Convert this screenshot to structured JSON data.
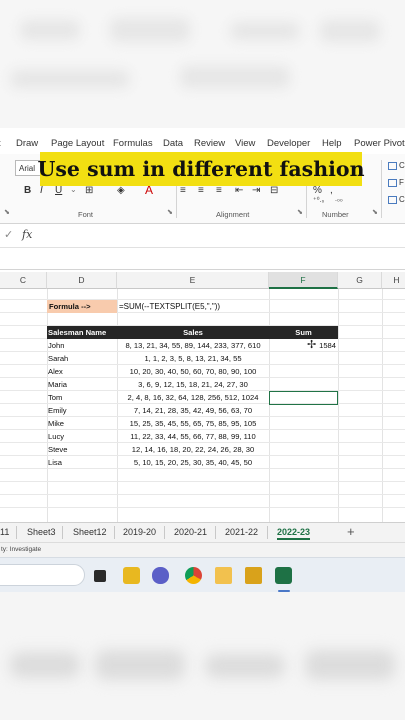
{
  "overlay": {
    "caption": "Use sum in different fashion"
  },
  "menu": {
    "items": [
      "t",
      "Draw",
      "Page Layout",
      "Formulas",
      "Data",
      "Review",
      "View",
      "Developer",
      "Help",
      "Power Pivot"
    ]
  },
  "ribbon": {
    "font_name": "Arial",
    "font_group_label": "Font",
    "alignment_group_label": "Alignment",
    "number_group_label": "Number",
    "bold": "B",
    "italic": "I",
    "underline": "U",
    "grow_font": "A",
    "shrink_font": "A",
    "font_color": "A",
    "side_items": [
      "C",
      "F",
      "C"
    ]
  },
  "formula_bar": {
    "fx": "fx"
  },
  "columns": [
    "C",
    "D",
    "E",
    "F",
    "G",
    "H"
  ],
  "active_column": "F",
  "sheet": {
    "formula_label": "Formula -->",
    "formula_text": "=SUM(--TEXTSPLIT(E5,\",\"))",
    "headers": {
      "salesman": "Salesman Name",
      "sales": "Sales",
      "sum": "Sum"
    },
    "rows": [
      {
        "name": "John",
        "sales": "8, 13, 21, 34, 55, 89, 144, 233, 377, 610",
        "sum": "1584"
      },
      {
        "name": "Sarah",
        "sales": "1, 1, 2, 3, 5, 8, 13, 21, 34, 55",
        "sum": ""
      },
      {
        "name": "Alex",
        "sales": "10, 20, 30, 40, 50, 60, 70, 80, 90, 100",
        "sum": ""
      },
      {
        "name": "Maria",
        "sales": "3, 6, 9, 12, 15, 18, 21, 24, 27, 30",
        "sum": ""
      },
      {
        "name": "Tom",
        "sales": "2, 4, 8, 16, 32, 64, 128, 256, 512, 1024",
        "sum": ""
      },
      {
        "name": "Emily",
        "sales": "7, 14, 21, 28, 35, 42, 49, 56, 63, 70",
        "sum": ""
      },
      {
        "name": "Mike",
        "sales": "15, 25, 35, 45, 55, 65, 75, 85, 95, 105",
        "sum": ""
      },
      {
        "name": "Lucy",
        "sales": "11, 22, 33, 44, 55, 66, 77, 88, 99, 110",
        "sum": ""
      },
      {
        "name": "Steve",
        "sales": "12, 14, 16, 18, 20, 22, 24, 26, 28, 30",
        "sum": ""
      },
      {
        "name": "Lisa",
        "sales": "5, 10, 15, 20, 25, 30, 35, 40, 45, 50",
        "sum": ""
      }
    ]
  },
  "tabs": {
    "items": [
      "11",
      "Sheet3",
      "Sheet12",
      "2019-20",
      "2020-21",
      "2021-22",
      "2022-23"
    ],
    "active": "2022-23",
    "add": "+"
  },
  "status": {
    "text": "ty: Investigate"
  },
  "taskbar": {
    "icons": [
      "desktop-icon",
      "pin-icon",
      "chat-icon",
      "chrome-icon",
      "folder-icon",
      "store-icon",
      "excel-icon"
    ]
  }
}
